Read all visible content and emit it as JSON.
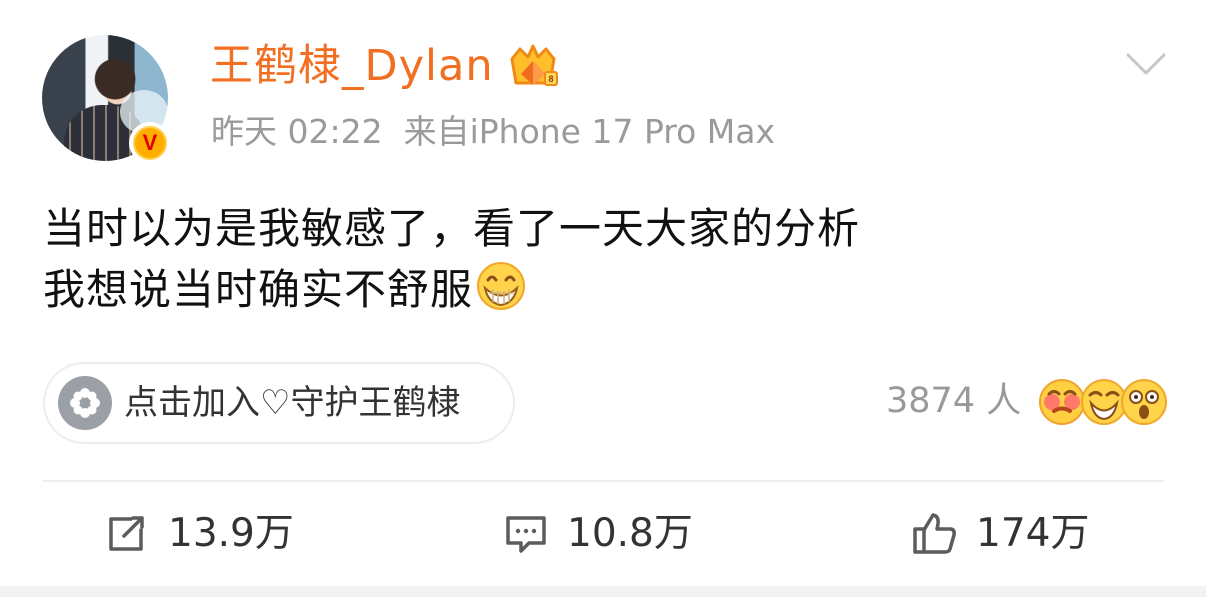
{
  "post": {
    "username": "王鹤棣_Dylan",
    "meta": {
      "time": "昨天 02:22",
      "source": "来自iPhone 17 Pro Max"
    },
    "text": {
      "line1": "当时以为是我敏感了，看了一天大家的分析",
      "line2": "我想说当时确实不舒服"
    },
    "join_button": {
      "label": "点击加入♡守护王鹤棣"
    },
    "people_count": "3874 人",
    "actions": {
      "repost_count": "13.9万",
      "comment_count": "10.8万",
      "like_count": "174万"
    },
    "colors": {
      "username": "#f26f21",
      "meta": "#9a9a9a",
      "accent_badge": "#ffae00"
    },
    "icons": {
      "more": "chevron-down-icon",
      "verified": "verified-badge-icon",
      "crown": "crown-icon",
      "grin": "grin-emoji-icon",
      "flower": "flower-icon",
      "repost": "repost-icon",
      "comment": "comment-icon",
      "like": "thumbs-up-icon"
    }
  }
}
